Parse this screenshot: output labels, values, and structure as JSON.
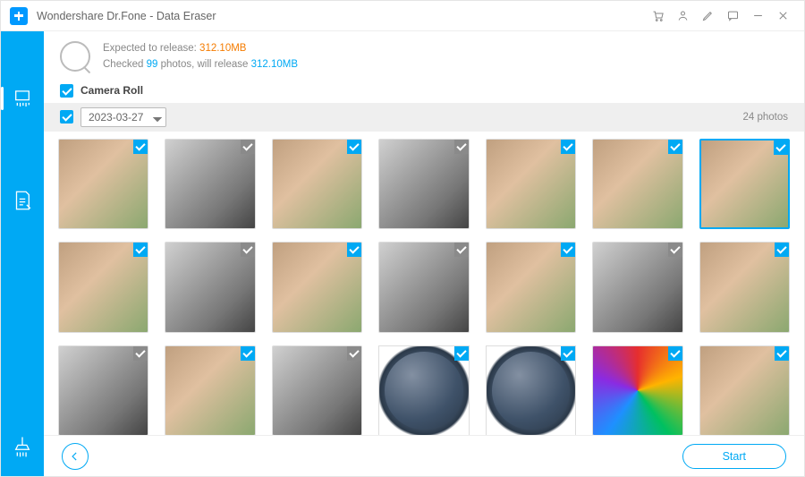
{
  "app_title": "Wondershare Dr.Fone - Data Eraser",
  "titlebar_icons": [
    "cart-icon",
    "user-icon",
    "edit-icon",
    "feedback-icon",
    "minimize-icon",
    "close-icon"
  ],
  "info": {
    "line1_prefix": "Expected to release: ",
    "expected_release": "312.10MB",
    "line2_a": "Checked ",
    "checked_count": "99",
    "line2_b": " photos, will release ",
    "will_release": "312.10MB"
  },
  "section": {
    "label": "Camera Roll",
    "checked": true
  },
  "date_group": {
    "selected": "2023-03-27",
    "count_label": "24 photos",
    "checked": true
  },
  "thumbs": [
    {
      "style": "color",
      "checked": true,
      "selected": false,
      "name": "photo-1"
    },
    {
      "style": "bw",
      "checked": true,
      "selected": false,
      "name": "photo-2"
    },
    {
      "style": "color",
      "checked": true,
      "selected": false,
      "name": "photo-3"
    },
    {
      "style": "bw",
      "checked": true,
      "selected": false,
      "name": "photo-4"
    },
    {
      "style": "color",
      "checked": true,
      "selected": false,
      "name": "photo-5"
    },
    {
      "style": "color",
      "checked": true,
      "selected": false,
      "name": "photo-6"
    },
    {
      "style": "color",
      "checked": true,
      "selected": true,
      "name": "photo-7"
    },
    {
      "style": "color",
      "checked": true,
      "selected": false,
      "name": "photo-8"
    },
    {
      "style": "bw",
      "checked": true,
      "selected": false,
      "name": "photo-9"
    },
    {
      "style": "color",
      "checked": true,
      "selected": false,
      "name": "photo-10"
    },
    {
      "style": "bw",
      "checked": true,
      "selected": false,
      "name": "photo-11"
    },
    {
      "style": "color",
      "checked": true,
      "selected": false,
      "name": "photo-12"
    },
    {
      "style": "bw",
      "checked": true,
      "selected": false,
      "name": "photo-13"
    },
    {
      "style": "color",
      "checked": true,
      "selected": false,
      "name": "photo-14"
    },
    {
      "style": "bw",
      "checked": true,
      "selected": false,
      "name": "photo-15"
    },
    {
      "style": "color",
      "checked": true,
      "selected": false,
      "name": "photo-16"
    },
    {
      "style": "bw",
      "checked": true,
      "selected": false,
      "name": "photo-17"
    },
    {
      "style": "globe",
      "checked": true,
      "selected": false,
      "name": "photo-18"
    },
    {
      "style": "globe",
      "checked": true,
      "selected": false,
      "name": "photo-19"
    },
    {
      "style": "art",
      "checked": true,
      "selected": false,
      "name": "photo-20"
    },
    {
      "style": "color",
      "checked": true,
      "selected": false,
      "name": "photo-21"
    }
  ],
  "footer": {
    "start_label": "Start"
  },
  "colors": {
    "accent": "#00a9f4",
    "highlight": "#f57c00"
  }
}
